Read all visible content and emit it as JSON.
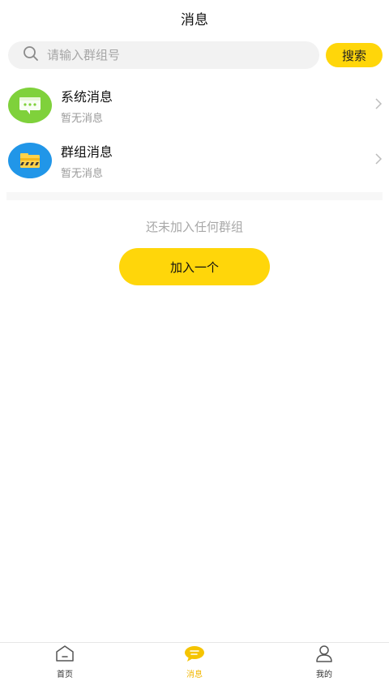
{
  "header": {
    "title": "消息"
  },
  "search": {
    "placeholder": "请输入群组号",
    "button_label": "搜索"
  },
  "messages": [
    {
      "title": "系统消息",
      "subtitle": "暂无消息",
      "icon": "system-message-icon",
      "color": "#7fd13b"
    },
    {
      "title": "群组消息",
      "subtitle": "暂无消息",
      "icon": "group-message-icon",
      "color": "#2196e8"
    }
  ],
  "empty_state": {
    "text": "还未加入任何群组",
    "button_label": "加入一个"
  },
  "tabbar": {
    "items": [
      {
        "label": "首页",
        "icon": "home-icon",
        "active": false
      },
      {
        "label": "消息",
        "icon": "message-icon",
        "active": true
      },
      {
        "label": "我的",
        "icon": "profile-icon",
        "active": false
      }
    ]
  },
  "colors": {
    "accent": "#ffd60a",
    "active_tab": "#f2b600"
  }
}
